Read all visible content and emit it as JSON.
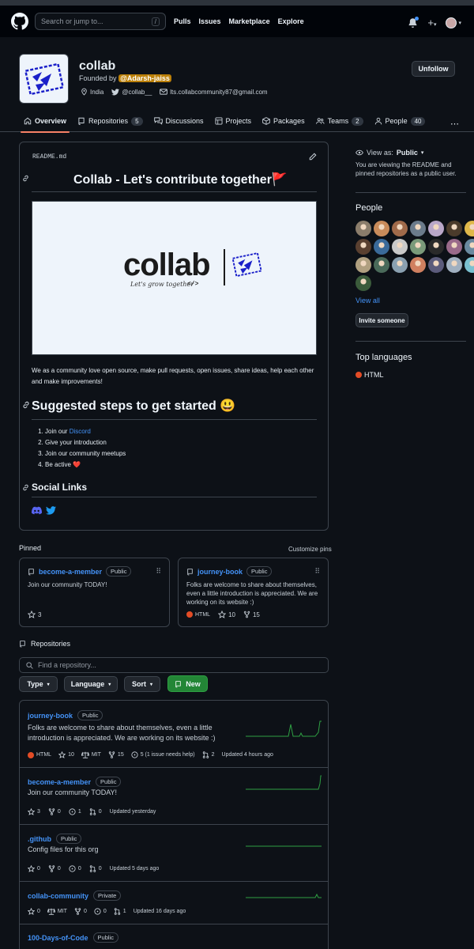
{
  "header": {
    "search_placeholder": "Search or jump to...",
    "slash_key": "/",
    "nav": [
      "Pulls",
      "Issues",
      "Marketplace",
      "Explore"
    ]
  },
  "org": {
    "name": "collab",
    "founded_prefix": "Founded by",
    "founder": "@Adarsh-jaiss",
    "location": "India",
    "twitter": "@collab__",
    "email": "lts.collabcommunity87@gmail.com",
    "unfollow_label": "Unfollow"
  },
  "tabs": [
    {
      "label": "Overview",
      "count": null
    },
    {
      "label": "Repositories",
      "count": "5"
    },
    {
      "label": "Discussions",
      "count": null
    },
    {
      "label": "Projects",
      "count": null
    },
    {
      "label": "Packages",
      "count": null
    },
    {
      "label": "Teams",
      "count": "2"
    },
    {
      "label": "People",
      "count": "40"
    }
  ],
  "readme": {
    "filename": "README.md",
    "title": "Collab - Let's contribute together",
    "title_emoji": "🚩",
    "banner_wordmark": "collab",
    "banner_tagline": "Let's grow together",
    "banner_code": "</>",
    "intro": "We as a community love open source, make pull requests, open issues, share ideas, help each other and make improvements!",
    "steps_title": "Suggested steps to get started",
    "steps_emoji": "😃",
    "steps": [
      {
        "prefix": "Join our ",
        "link": "Discord"
      },
      {
        "prefix": "Give your introduction",
        "link": ""
      },
      {
        "prefix": "Join our community meetups",
        "link": ""
      },
      {
        "prefix": "Be active ",
        "link": ""
      }
    ],
    "heart": "❤️",
    "social_title": "Social Links"
  },
  "sidebar": {
    "view_as_label": "View as:",
    "view_as_value": "Public",
    "view_as_desc": "You are viewing the README and pinned repositories as a public user.",
    "people_title": "People",
    "view_all": "View all",
    "invite_label": "Invite someone",
    "langs_title": "Top languages",
    "lang": "HTML",
    "lang_color": "#e34c26"
  },
  "pinned": {
    "title": "Pinned",
    "customize": "Customize pins",
    "cards": [
      {
        "name": "become-a-member",
        "badge": "Public",
        "desc": "Join our community TODAY!",
        "lang": "",
        "stars": "3",
        "forks": ""
      },
      {
        "name": "journey-book",
        "badge": "Public",
        "desc": "Folks are welcome to share about themselves, even a little introduction is appreciated. We are working on its website :)",
        "lang": "HTML",
        "stars": "10",
        "forks": "15"
      }
    ]
  },
  "repositories": {
    "title": "Repositories",
    "find_placeholder": "Find a repository...",
    "type_label": "Type",
    "language_label": "Language",
    "sort_label": "Sort",
    "new_label": "New",
    "items": [
      {
        "name": "journey-book",
        "badge": "Public",
        "desc": "Folks are welcome to share about themselves, even a little introduction is appreciated. We are working on its website :)",
        "lang": "HTML",
        "stars": "10",
        "license": "MIT",
        "forks": "15",
        "issues": "5 (1 issue needs help)",
        "prs": "2",
        "updated": "Updated 4 hours ago"
      },
      {
        "name": "become-a-member",
        "badge": "Public",
        "desc": "Join our community TODAY!",
        "stars": "3",
        "forks": "0",
        "issues": "1",
        "prs": "0",
        "updated": "Updated yesterday"
      },
      {
        "name": ".github",
        "badge": "Public",
        "desc": "Config files for this org",
        "stars": "0",
        "forks": "0",
        "issues": "0",
        "prs": "0",
        "updated": "Updated 5 days ago"
      },
      {
        "name": "collab-community",
        "badge": "Private",
        "desc": "",
        "stars": "0",
        "license": "MIT",
        "forks": "0",
        "issues": "0",
        "prs": "1",
        "updated": "Updated 16 days ago"
      },
      {
        "name": "100-Days-of-Code",
        "badge": "Public",
        "desc": "",
        "updated": ""
      }
    ]
  },
  "colors": {
    "bg": "#0d1117",
    "link": "#4493f8",
    "accent_tab": "#f78166",
    "green": "#238636",
    "spark": "#2ea043"
  }
}
